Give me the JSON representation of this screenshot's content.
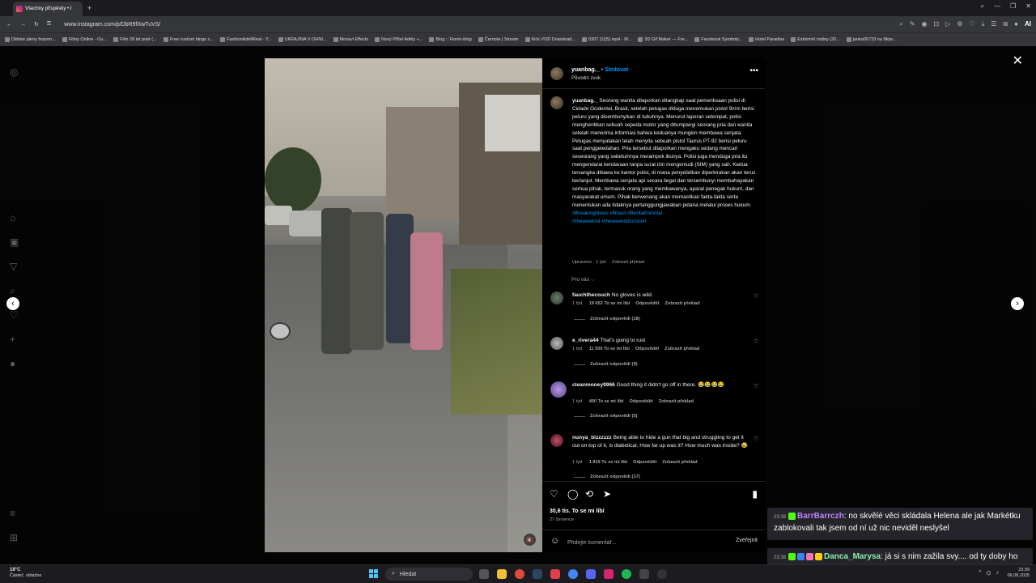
{
  "browser": {
    "tab_title": "Všechny příspěvky • I",
    "new_tab": "+",
    "url": "www.instagram.com/p/DbR9fXwTuVS/",
    "window_controls": [
      "—",
      "❐",
      "✕"
    ],
    "right_badge": "AI",
    "bookmarks": [
      "Dětské pleny hrazen...",
      "Filmy Online - Ou...",
      "Film 28 let poté (...",
      "Free custom bingo c...",
      "FashionAdellReal - Y...",
      "UKRAJINA V OHNI...",
      "Movavi Effects",
      "Nový Přítel Adély +...",
      "Blog :: Fionin-blog",
      "Černota | Stream",
      "Kick VOD Download...",
      "0307 (1)(5).mp4 - M...",
      "3D Gif Maker — Fre...",
      "Facebook Symboly...",
      "Hotel Paradise",
      "Extrémní rodiny (20...",
      "janka00733 na Moje..."
    ]
  },
  "post": {
    "username": "yuanbag._",
    "dot": "•",
    "follow_label": "Sledovat",
    "audio": "Původní zvuk",
    "more": "•••",
    "caption_user": "yuanbag._",
    "caption_text": "Seorang wanita dilaporkan ditangkap saat pemeriksaan polisi di Cidade Ocidental, Brasil, setelah petugas diduga menemukan pistol 9mm berisi peluru yang disembunyikan di tubuhnya. Menurut laporan setempat, polisi menghentikan sebuah sepeda motor yang ditumpangi seorang pria dan wanita setelah menerima informasi bahwa keduanya mungkin membawa senjata. Petugas menyatakan telah menyita sebuah pistol Taurus PT-92 berisi peluru saat penggeledahan. Pria tersebut dilaporkan mengaku sedang mencari seseorang yang sebelumnya merampok ibunya. Polisi juga menduga pria itu mengendarai kendaraan tanpa surat izin mengemudi (SIM) yang sah. Kedua tersangka dibawa ke kantor polisi, di mana penyelidikan diperkirakan akan terus berlanjut. Membawa senjata api secara ilegal dan tersembunyi membahayakan semua pihak, termasuk orang yang membawanya, aparat penegak hukum, dan masyarakat umum. Pihak berwenang akan memastikan fakta-fakta serta menentukan ada tidaknya pertanggungjawaban pidana melalui proses hukum.",
    "hashtags_1": "#BreakingNews #Brasil #BeritaKriminal",
    "hashtags_2": "#theweeknd #theweekndconcert",
    "caption_edited": "Upraveno · 1 týd.",
    "caption_translate": "Zobrazit překlad",
    "for_you": "Pro vás ⌵",
    "comments": [
      {
        "user": "fauchthecouch",
        "text": "No gloves is wild.",
        "age": "1 týd.",
        "likes": "19 653 To se mi líbí",
        "reply": "Odpovědět",
        "translate": "Zobrazit překlad",
        "replies": "Zobrazit odpovědi (18)"
      },
      {
        "user": "e_rivera44",
        "text": "That's going to rust",
        "age": "1 týd.",
        "likes": "11 505 To se mi líbí",
        "reply": "Odpovědět",
        "translate": "Zobrazit překlad",
        "replies": "Zobrazit odpovědi (9)"
      },
      {
        "user": "cleanmoney9966",
        "text": "Good thing it didn't go off in there. 😂😂😂😂",
        "age": "1 týd.",
        "likes": "400 To se mi líbí",
        "reply": "Odpovědět",
        "translate": "Zobrazit překlad",
        "replies": "Zobrazit odpovědi (5)"
      },
      {
        "user": "nunya_bizzzzzz",
        "text": "Being able to hide a gun that big and struggling to get it out on top of it, is diabolical. How far up was it? How much was inside? 😂",
        "age": "1 týd.",
        "likes": "1 819 To se mi líbí",
        "reply": "Odpovědět",
        "translate": "Zobrazit překlad",
        "replies": "Zobrazit odpovědi (17)"
      }
    ],
    "likes_count": "30,6 tis. To se mi líbí",
    "date": "27 července",
    "comment_placeholder": "Přidejte komentář...",
    "publish_label": "Zveřejnit"
  },
  "chat": [
    {
      "time": "23:38",
      "name": "BarrBarrczh",
      "name_color": "#c084fc",
      "text": ": no skvělé věci skládala Helena ale jak Markétku zablokovali tak jsem od ní už nic neviděl neslyšel"
    },
    {
      "time": "23:38",
      "name": "Danca_Marysa",
      "name_color": "#86efac",
      "text": ": já si s nim zažila svy.... od ty doby ho nenávidim"
    }
  ],
  "taskbar": {
    "temp": "18°C",
    "weather": "Částeč. oblačno",
    "search": "Hledat",
    "time": "23:39",
    "date": "06.08.2025"
  },
  "colors": {
    "accent": "#0095f6",
    "chat_bg": "#26262c"
  }
}
